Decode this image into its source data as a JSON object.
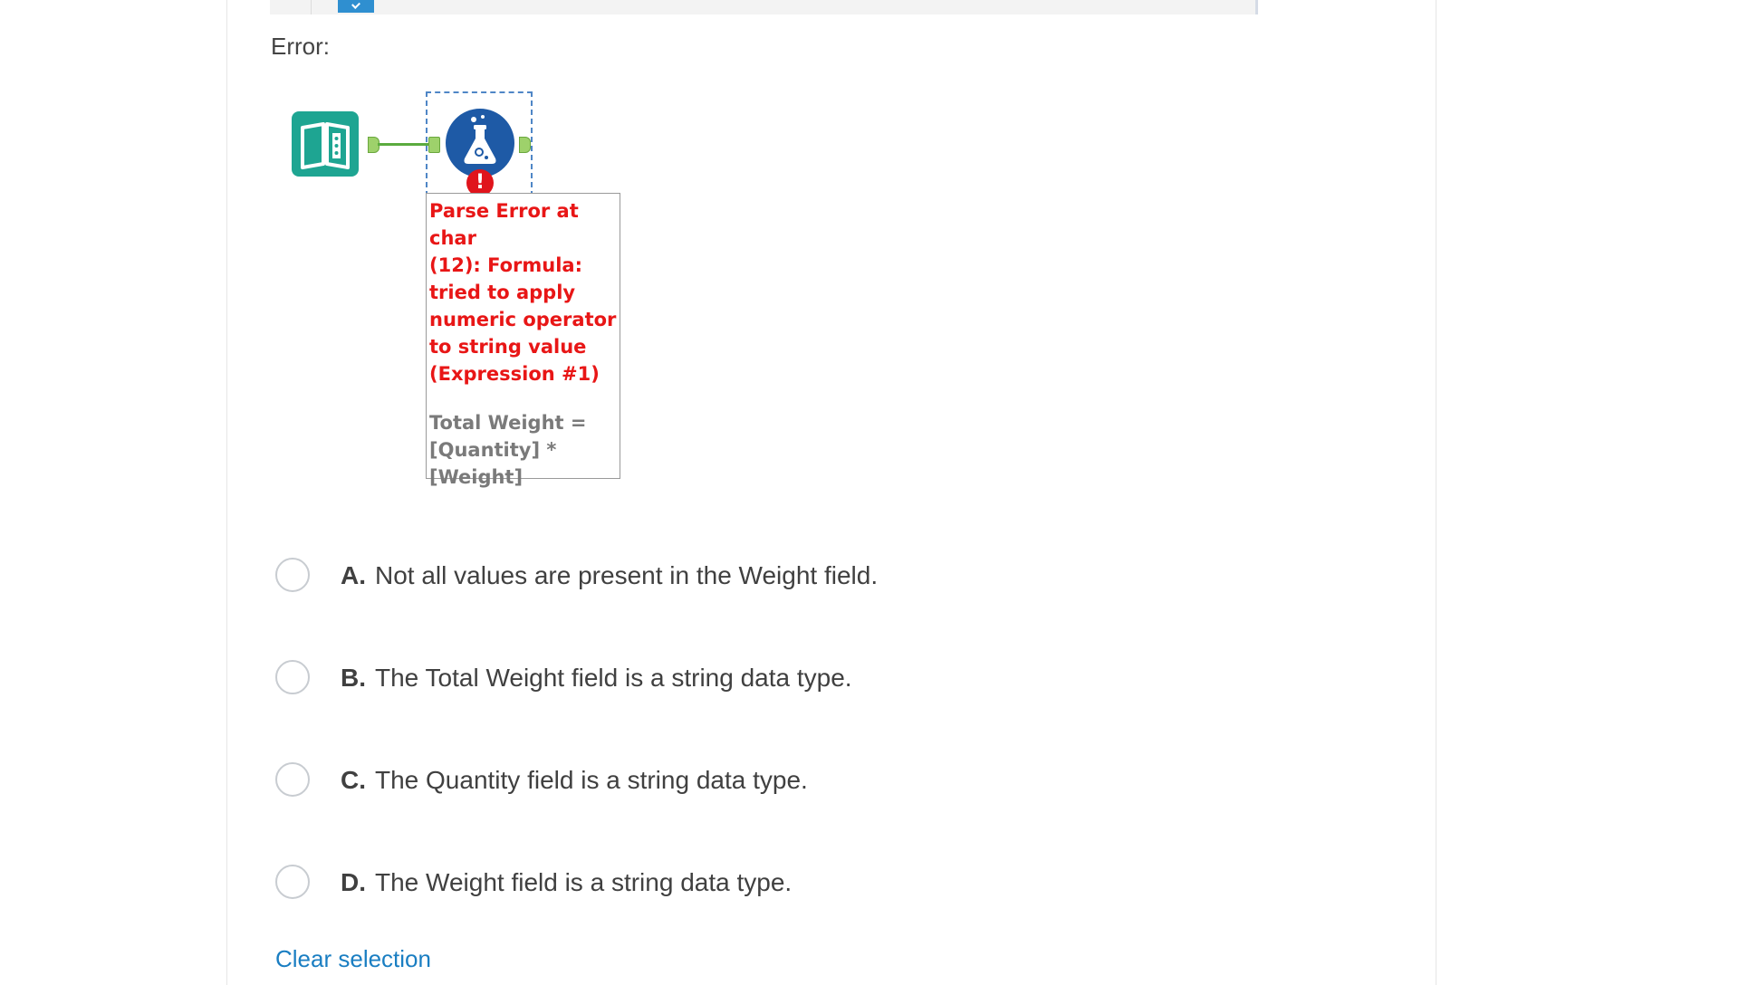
{
  "question": {
    "error_label": "Error:",
    "workflow": {
      "input_tool_icon": "book-icon",
      "formula_tool_icon": "flask-icon",
      "error_badge_icon": "exclamation-icon",
      "error_message": "Parse Error at char\n(12): Formula:\ntried to apply\nnumeric operator\nto string value\n(Expression #1)",
      "expression": "Total Weight =\n[Quantity] *\n[Weight]"
    },
    "options": [
      {
        "letter": "A.",
        "text": "Not all values are present in the Weight field.",
        "selected": false
      },
      {
        "letter": "B.",
        "text": "The Total Weight field is a string data type.",
        "selected": false
      },
      {
        "letter": "C.",
        "text": "The Quantity field is a string data type.",
        "selected": false
      },
      {
        "letter": "D.",
        "text": "The Weight field is a string data type.",
        "selected": false
      }
    ],
    "clear_selection_label": "Clear selection"
  },
  "colors": {
    "input_tool": "#1ea592",
    "formula_tool": "#1e5aa6",
    "error_red": "#e81616",
    "link_blue": "#1a7ec2"
  }
}
